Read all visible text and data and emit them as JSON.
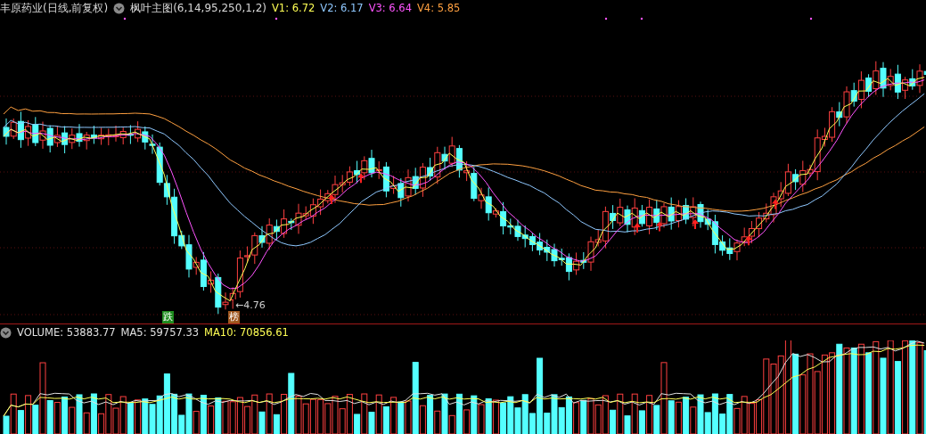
{
  "header": {
    "stock_title": "丰原药业(日线,前复权)",
    "indicator": "枫叶主图(6,14,95,250,1,2)",
    "legend": [
      {
        "label": "V1:",
        "value": "6.72",
        "color": "#ffff54"
      },
      {
        "label": "V2:",
        "value": "6.17",
        "color": "#8fc8ff"
      },
      {
        "label": "V3:",
        "value": "6.64",
        "color": "#ff54ff"
      },
      {
        "label": "V4:",
        "value": "5.85",
        "color": "#ffa040"
      }
    ]
  },
  "chart_marks": {
    "low_label": "←4.76",
    "badges": [
      {
        "text": "跌",
        "color": "#1e8c1e"
      },
      {
        "text": "榜",
        "color": "#a0561e"
      }
    ]
  },
  "volume_panel": {
    "legend": [
      {
        "label": "VOLUME:",
        "value": "53883.77",
        "color": "#e0e0e0"
      },
      {
        "label": "MA5:",
        "value": "59757.33",
        "color": "#e0e0e0"
      },
      {
        "label": "MA10:",
        "value": "70856.61",
        "color": "#ffff54"
      }
    ]
  }
}
